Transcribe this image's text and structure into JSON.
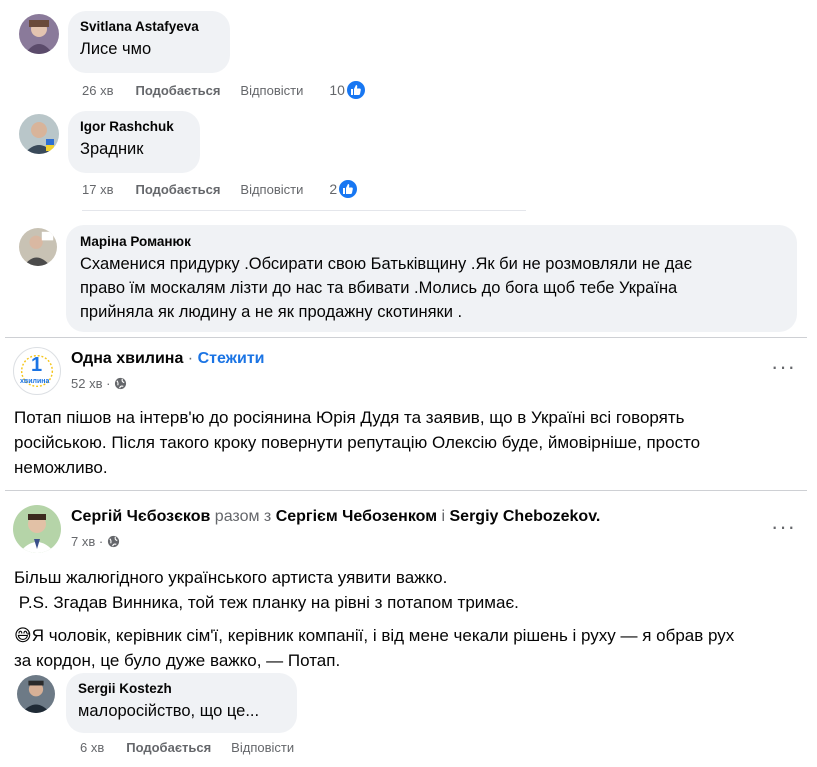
{
  "comments_top": [
    {
      "author": "Svitlana Astafyeva",
      "text": "Лисе чмо",
      "time": "26 хв",
      "like_label": "Подобається",
      "reply_label": "Відповісти",
      "reactions": "10"
    },
    {
      "author": "Igor Rashchuk",
      "text": "Зрадник",
      "time": "17 хв",
      "like_label": "Подобається",
      "reply_label": "Відповісти",
      "reactions": "2"
    },
    {
      "author": "Маріна Романюк",
      "line1": "Схаменися придурку .Обсирати свою Батьківщину .Як би не розмовляли не дає",
      "line2": "право їм москалям лізти до нас та вбивати .Молись до бога щоб тебе Україна",
      "line3": "прийняла як людину а не як продажну скотиняки ."
    }
  ],
  "post1": {
    "page_name": "Одна хвилина",
    "separator": "·",
    "follow_label": "Стежити",
    "time": "52 хв ·",
    "more_icon": "···",
    "logo_number": "1",
    "logo_text": "хвилина",
    "line1": "Потап пішов на інтерв'ю до росіянина Юрія Дудя та заявив, що в Україні всі говорять",
    "line2": "російською. Після такого кроку повернути репутацію Олексію буде, ймовірніше, просто",
    "line3": "неможливо."
  },
  "post2": {
    "author": "Сергій Чєбозєков",
    "with_text": "разом з",
    "tag1": "Сергієм Чебозенком",
    "and_text": "і",
    "tag2": "Sergiy Chebozekov",
    "period": ".",
    "time": "7 хв ·",
    "more_icon": "···",
    "line1": "Більш жалюгідного українського артиста уявити важко.",
    "line2": " P.S. Згадав Винника, той теж планку на рівні з потапом тримає.",
    "emoji": "😅",
    "line3": "Я чоловік, керівник сім'ї, керівник компанії, і від мене чекали рішень і руху — я обрав рух",
    "line4": "за кордон, це було дуже важко, — Потап."
  },
  "comment_bottom": {
    "author": "Sergii Kostezh",
    "text": "малоросійство, що це...",
    "time": "6 хв",
    "like_label": "Подобається",
    "reply_label": "Відповісти"
  },
  "colors": {
    "accent": "#1b74e4",
    "bubble": "#f0f2f5",
    "secondary_text": "#65676b",
    "like_blue": "#1877f2"
  }
}
